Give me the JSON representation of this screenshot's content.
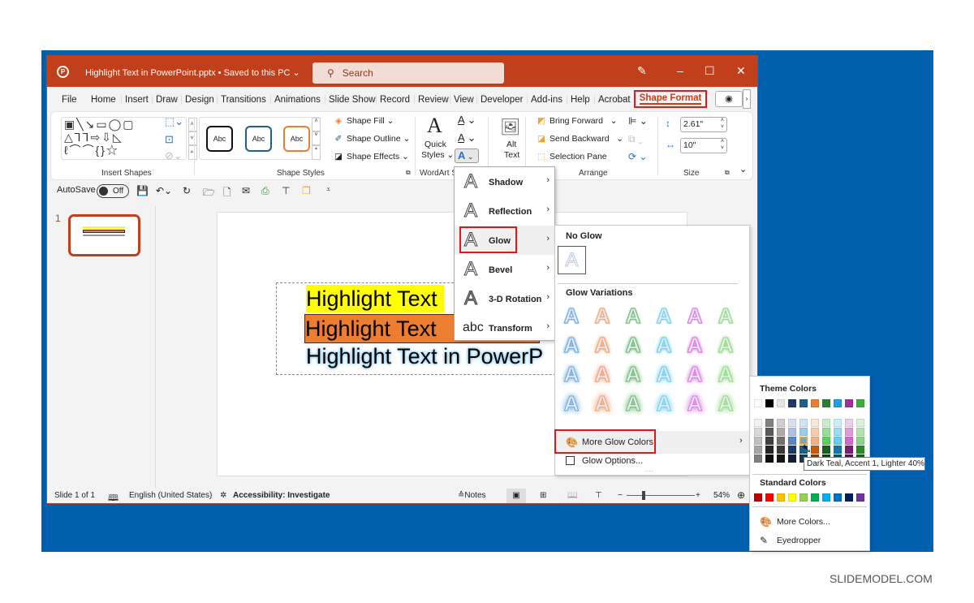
{
  "window": {
    "title": "Highlight Text in PowerPoint.pptx • Saved to this PC ⌄",
    "search_placeholder": "Search",
    "controls": {
      "pen": "✎",
      "minimize": "–",
      "maximize": "☐",
      "close": "✕"
    }
  },
  "tabs": [
    "File",
    "Home",
    "Insert",
    "Draw",
    "Design",
    "Transitions",
    "Animations",
    "Slide Show",
    "Record",
    "Review",
    "View",
    "Developer",
    "Add-ins",
    "Help",
    "Acrobat"
  ],
  "active_tab": "Shape Format",
  "ribbon": {
    "insert_shapes_label": "Insert Shapes",
    "shapes_row1": "▣╲↘▭◯▢",
    "shapes_row2": "△⅂⅂⇨⇩◺",
    "shapes_row3": "ℓ⌒⌒{}☆",
    "shape_styles_label": "Shape Styles",
    "style_abc": [
      "Abc",
      "Abc",
      "Abc"
    ],
    "shape_fill": "Shape Fill ⌄",
    "shape_outline": "Shape Outline ⌄",
    "shape_effects": "Shape Effects ⌄",
    "wordart_label": "WordArt S",
    "quick_styles": "Quick",
    "quick_styles2": "Styles ⌄",
    "alt_text1": "Alt",
    "alt_text2": "Text",
    "bring_forward": "Bring Forward",
    "send_backward": "Send Backward",
    "selection_pane": "Selection Pane",
    "arrange_label": "Arrange",
    "height": "2.61\"",
    "width": "10\"",
    "size_label": "Size"
  },
  "qat": {
    "autosave_label": "AutoSave",
    "autosave_state": "Off"
  },
  "thumbnail": {
    "number": "1"
  },
  "slide": {
    "line1": "Highlight Text",
    "line2": "Highlight Text",
    "line3": "Highlight Text in PowerP",
    "highlight1": "#ffff00",
    "highlight2": "#ed7d31",
    "glow_color": "#9dd3f0"
  },
  "statusbar": {
    "slide": "Slide 1 of 1",
    "language": "English (United States)",
    "accessibility": "Accessibility: Investigate",
    "notes": "Notes",
    "zoom": "54%"
  },
  "text_effects_menu": [
    {
      "label": "Shadow",
      "icon": "A"
    },
    {
      "label": "Reflection",
      "icon": "A"
    },
    {
      "label": "Glow",
      "icon": "A"
    },
    {
      "label": "Bevel",
      "icon": "A"
    },
    {
      "label": "3-D Rotation",
      "icon": "A"
    },
    {
      "label": "Transform",
      "icon": "abc"
    }
  ],
  "glow_menu": {
    "no_glow": "No Glow",
    "variations": "Glow Variations",
    "more_colors": "More Glow Colors",
    "options": "Glow Options...",
    "colors": [
      "#7ab0dc",
      "#f4a57a",
      "#7cc07c",
      "#78d0f0",
      "#e080e0",
      "#98dc88"
    ]
  },
  "color_palette": {
    "theme_header": "Theme Colors",
    "theme_top": [
      "#ffffff",
      "#000000",
      "#e7e6e6",
      "#1f3864",
      "#1f5f8b",
      "#ed7d31",
      "#2e7d32",
      "#1ea0dc",
      "#a0309a",
      "#3cae3c"
    ],
    "theme_shades": [
      [
        "#f2f2f2",
        "#d9d9d9",
        "#bfbfbf",
        "#a6a6a6",
        "#808080"
      ],
      [
        "#808080",
        "#595959",
        "#404040",
        "#262626",
        "#0d0d0d"
      ],
      [
        "#d0cece",
        "#aeaaaa",
        "#757171",
        "#3b3838",
        "#171616"
      ],
      [
        "#d6e0f0",
        "#adc1e1",
        "#5b87c5",
        "#1f3864",
        "#131f3a"
      ],
      [
        "#cde4f4",
        "#9bcaea",
        "#5aaddf",
        "#1f5f8b",
        "#133a55"
      ],
      [
        "#fbe5d6",
        "#f8cbad",
        "#f4b183",
        "#c55a11",
        "#843c0c"
      ],
      [
        "#c9efc9",
        "#93df93",
        "#5ccf5c",
        "#1f5e21",
        "#143e15"
      ],
      [
        "#cceefa",
        "#99ddf5",
        "#66cdf0",
        "#1578a5",
        "#0e506e"
      ],
      [
        "#f0cdee",
        "#e19bdd",
        "#d269cc",
        "#781f73",
        "#50154c"
      ],
      [
        "#d8f1d8",
        "#b1e3b1",
        "#8ad58a",
        "#2a8a2a",
        "#1c5c1c"
      ]
    ],
    "standard_header": "Standard Colors",
    "standard": [
      "#c00000",
      "#ff0000",
      "#ffc000",
      "#ffff00",
      "#92d050",
      "#00b050",
      "#00b0f0",
      "#0070c0",
      "#002060",
      "#7030a0"
    ],
    "more_colors": "More Colors...",
    "eyedropper": "Eyedropper",
    "tooltip": "Dark Teal, Accent 1, Lighter 40%"
  },
  "watermark": "SLIDEMODEL.COM"
}
